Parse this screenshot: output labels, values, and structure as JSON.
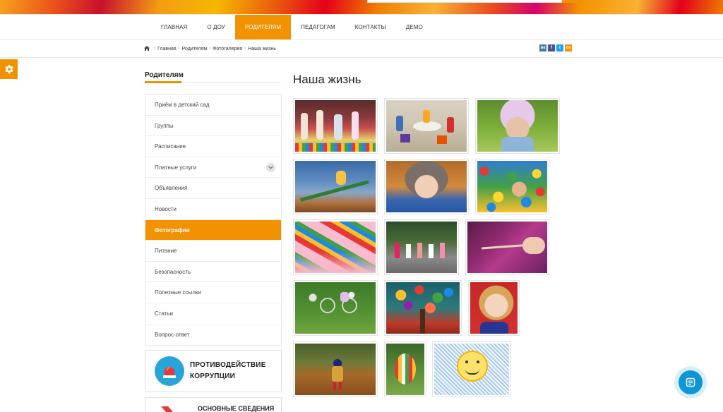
{
  "nav": {
    "items": [
      {
        "label": "ГЛАВНАЯ"
      },
      {
        "label": "О ДОУ"
      },
      {
        "label": "РОДИТЕЛЯМ"
      },
      {
        "label": "ПЕДАГОГАМ"
      },
      {
        "label": "КОНТАКТЫ"
      },
      {
        "label": "ДЕМО"
      }
    ],
    "active_index": 2
  },
  "breadcrumb": {
    "items": [
      "Главная",
      "Родителям",
      "Фотогалерея",
      "Наша жизнь"
    ]
  },
  "share": {
    "icons": [
      "vk-icon",
      "facebook-icon",
      "twitter-icon",
      "odnoklassniki-icon"
    ],
    "labels": [
      "вк",
      "f",
      "t",
      "ок"
    ],
    "colors": [
      "#4a76a8",
      "#3b5998",
      "#1da1f2",
      "#f39200"
    ]
  },
  "sidebar": {
    "title": "Родителям",
    "items": [
      {
        "label": "Приём в детский сад"
      },
      {
        "label": "Группы"
      },
      {
        "label": "Расписание"
      },
      {
        "label": "Платные услуги"
      },
      {
        "label": "Объявления"
      },
      {
        "label": "Новости"
      },
      {
        "label": "Фотографии"
      },
      {
        "label": "Питание"
      },
      {
        "label": "Безопасность"
      },
      {
        "label": "Полезные ссылки"
      },
      {
        "label": "Статьи"
      },
      {
        "label": "Вопрос-ответ"
      }
    ],
    "active_index": 6,
    "expandable_index": 3
  },
  "promos": {
    "anticorruption": {
      "line1": "ПРОТИВОДЕЙСТВИЕ",
      "line2": "КОРРУПЦИИ"
    },
    "basic_info": {
      "line1": "ОСНОВНЫЕ СВЕДЕНИЯ"
    }
  },
  "main": {
    "title": "Наша жизнь"
  },
  "colors": {
    "accent": "#f39200",
    "chat": "#0d95d8"
  }
}
